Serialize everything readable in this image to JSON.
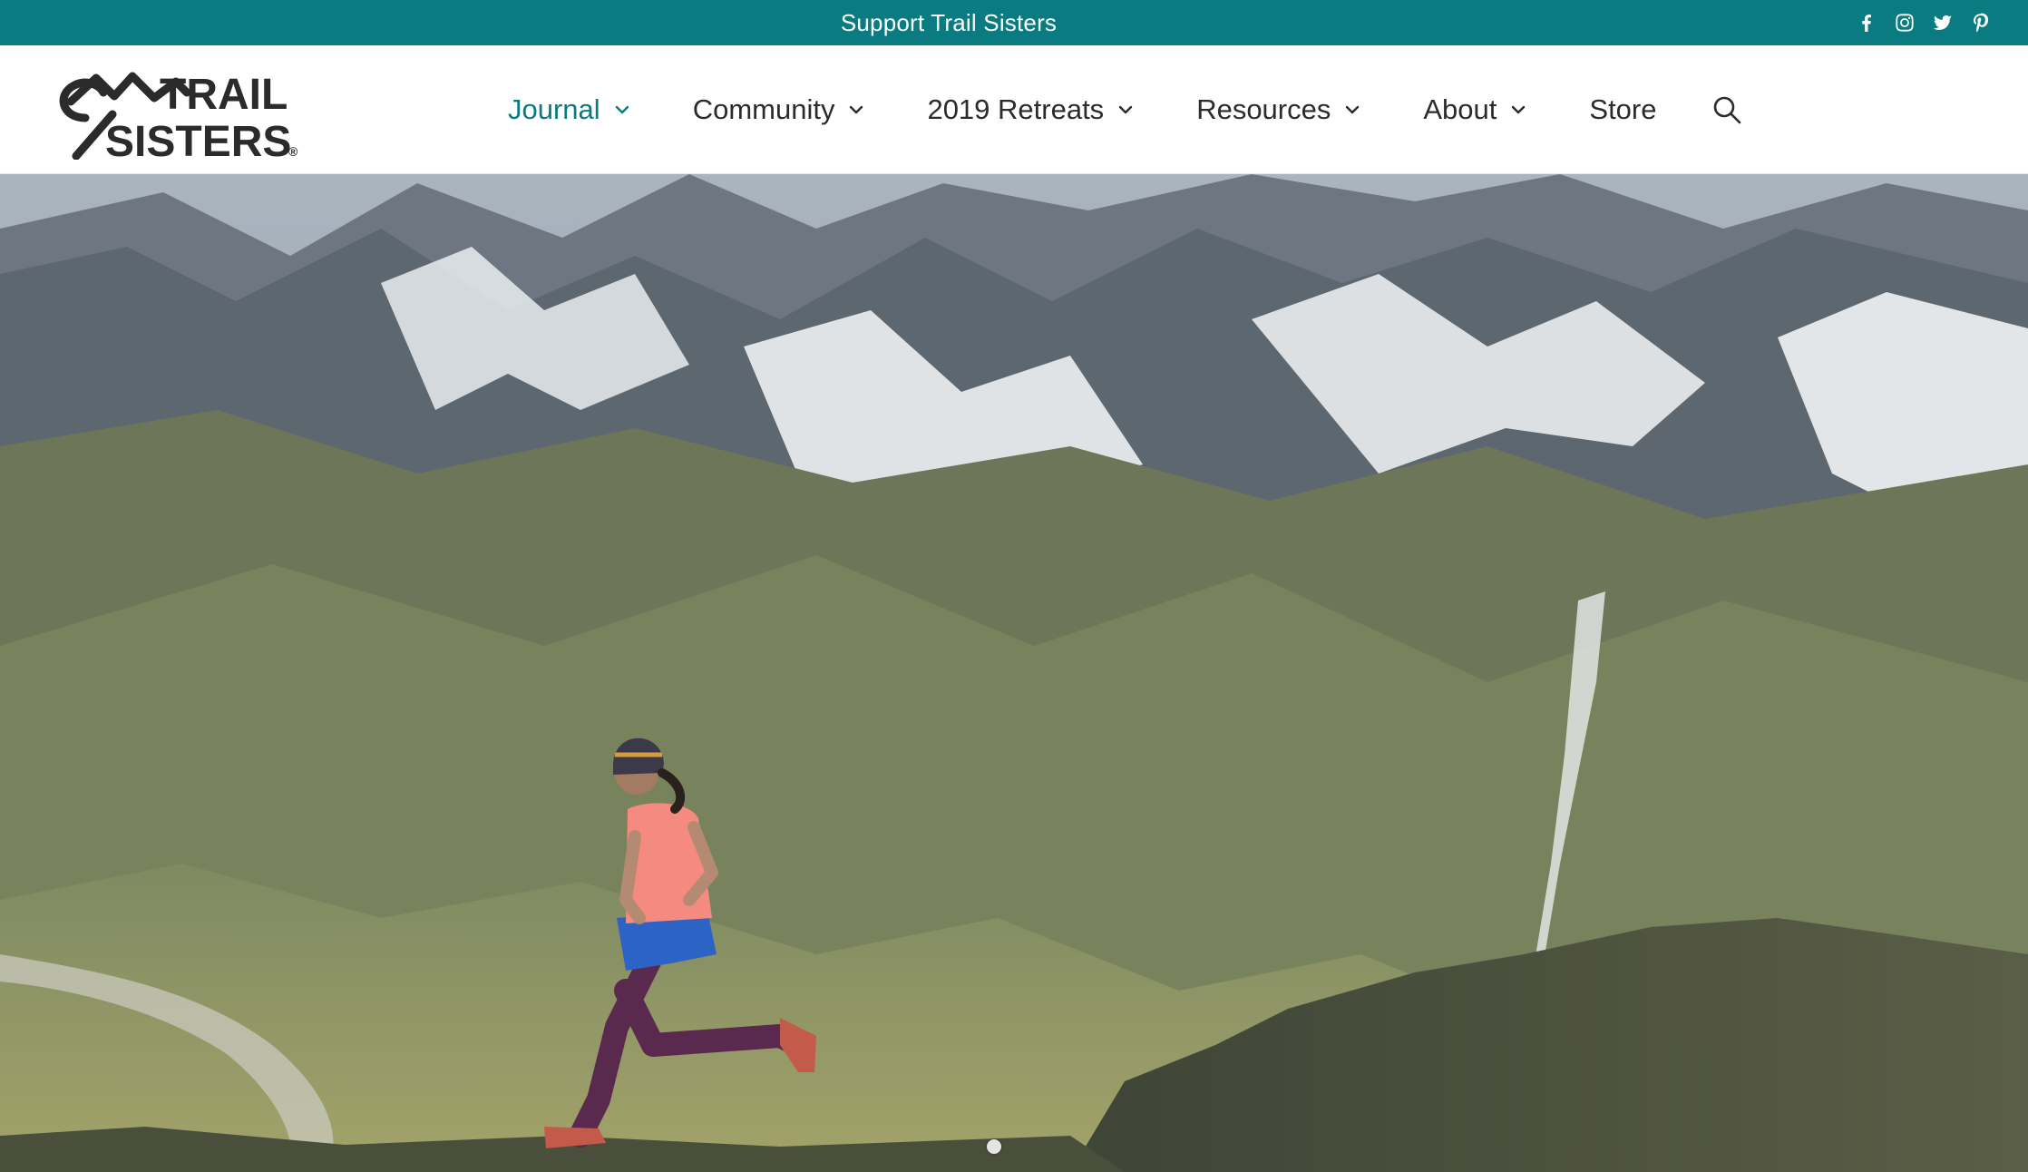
{
  "topbar": {
    "support_label": "Support Trail Sisters",
    "background": "#0b7b82",
    "social": [
      {
        "icon": "facebook-icon"
      },
      {
        "icon": "instagram-icon"
      },
      {
        "icon": "twitter-icon"
      },
      {
        "icon": "pinterest-icon"
      }
    ]
  },
  "brand": {
    "line1": "TRAIL",
    "line2": "SISTERS",
    "mark": "®"
  },
  "nav": {
    "accent": "#0b7b82",
    "items": [
      {
        "label": "Journal",
        "has_dropdown": true,
        "active": true
      },
      {
        "label": "Community",
        "has_dropdown": true,
        "active": false
      },
      {
        "label": "2019 Retreats",
        "has_dropdown": true,
        "active": false
      },
      {
        "label": "Resources",
        "has_dropdown": true,
        "active": false
      },
      {
        "label": "About",
        "has_dropdown": true,
        "active": false
      },
      {
        "label": "Store",
        "has_dropdown": false,
        "active": false
      }
    ],
    "search_icon": "search-icon"
  },
  "hero": {
    "image": "runner-on-mountain-ridge",
    "slides": 1,
    "active_slide": 1
  }
}
